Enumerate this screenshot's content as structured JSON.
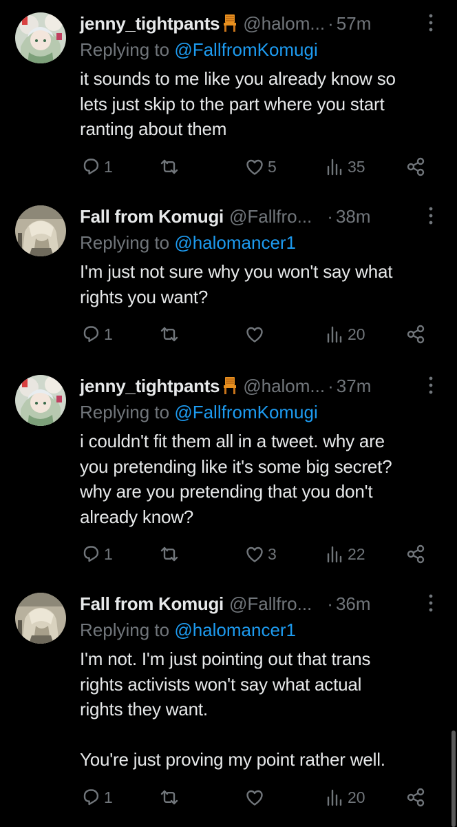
{
  "colors": {
    "background": "#000000",
    "text": "#e7e9ea",
    "muted": "#71767b",
    "link": "#1d9bf0"
  },
  "tweets": [
    {
      "display_name": "jenny_tightpants",
      "name_emoji": "chair-icon",
      "handle": "@halom...",
      "separator": "·",
      "time": "57m",
      "replying_prefix": "Replying to ",
      "replying_to": "@FallfromKomugi",
      "text": "it sounds to me like you already know so\nlets just skip to the part where you start\nranting about them",
      "replies": "1",
      "retweets": "",
      "likes": "5",
      "views": "35"
    },
    {
      "display_name": "Fall from Komugi",
      "handle": "@Fallfro...",
      "separator": "·",
      "time": "38m",
      "replying_prefix": "Replying to ",
      "replying_to": "@halomancer1",
      "text": "I'm just not sure why you won't say what\nrights you want?",
      "replies": "1",
      "retweets": "",
      "likes": "",
      "views": "20"
    },
    {
      "display_name": "jenny_tightpants",
      "name_emoji": "chair-icon",
      "handle": "@halom...",
      "separator": "·",
      "time": "37m",
      "replying_prefix": "Replying to ",
      "replying_to": "@FallfromKomugi",
      "text": "i couldn't fit them all in a tweet. why are\nyou pretending like it's some big secret?\nwhy are you pretending that you don't\nalready know?",
      "replies": "1",
      "retweets": "",
      "likes": "3",
      "views": "22"
    },
    {
      "display_name": "Fall from Komugi",
      "handle": "@Fallfro...",
      "separator": "·",
      "time": "36m",
      "replying_prefix": "Replying to ",
      "replying_to": "@halomancer1",
      "text": "I'm not. I'm just pointing out that trans\nrights activists won't say what actual\nrights they want.\n\nYou're just proving my point rather well.",
      "replies": "1",
      "retweets": "",
      "likes": "",
      "views": "20"
    }
  ]
}
